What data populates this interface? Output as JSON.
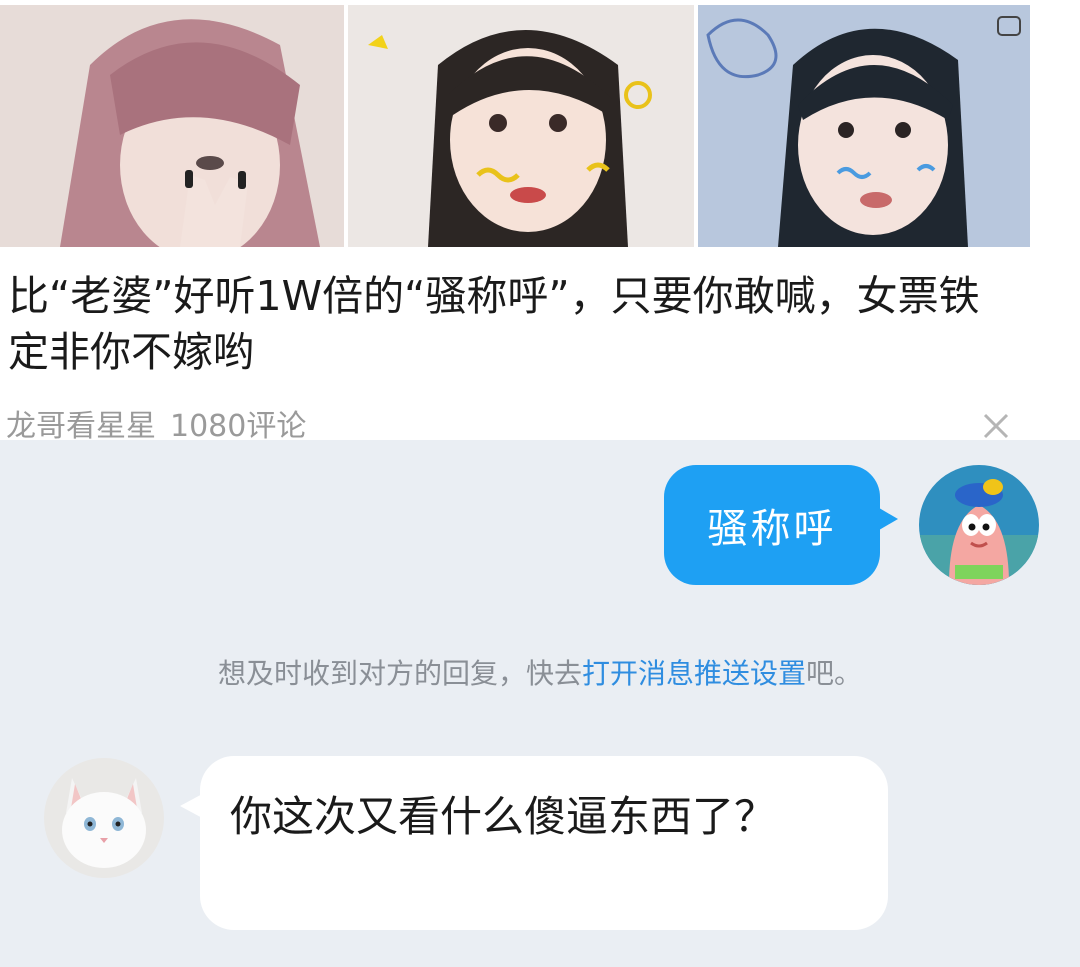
{
  "article": {
    "headline": "比“老婆”好听1W倍的“骚称呼”，只要你敢喊，女票铁定非你不嫁哟",
    "author": "龙哥看星星",
    "comments": "1080评论",
    "close_icon": "close-icon",
    "thumbnails": [
      "photo-pink-hair-girl",
      "photo-girl-doodles",
      "photo-girl-blue-doodles"
    ]
  },
  "chat": {
    "outgoing_message": "骚称呼",
    "notice_prefix": "想及时收到对方的回复，快去",
    "notice_link": "打开消息推送设置",
    "notice_suffix": "吧。",
    "incoming_message": "你这次又看什么傻逼东西了？",
    "avatar_me": "patrick-star-avatar",
    "avatar_other": "white-cat-avatar"
  },
  "colors": {
    "accent": "#1ea0f3",
    "link": "#2f8de0",
    "chat_background": "#eaeef3"
  }
}
